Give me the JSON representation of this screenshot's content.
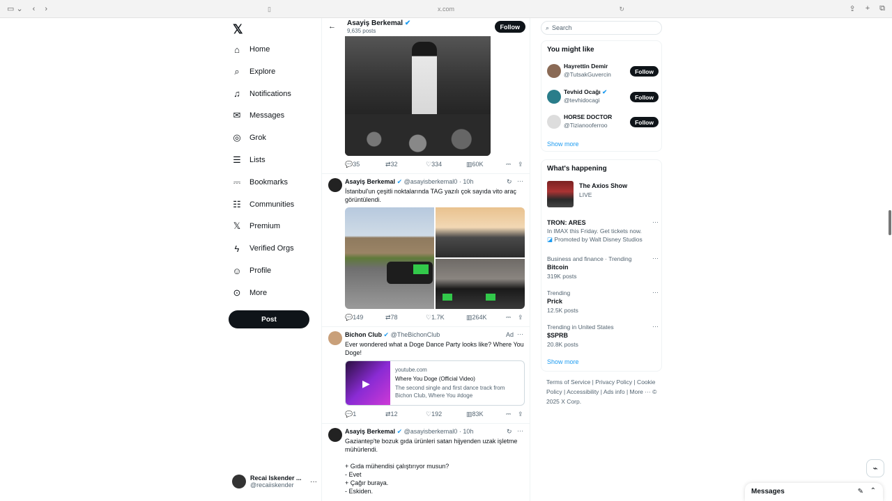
{
  "browser": {
    "url": "x.com"
  },
  "nav": {
    "items": [
      {
        "label": "Home",
        "icon": "home-icon",
        "glyph": "⌂"
      },
      {
        "label": "Explore",
        "icon": "search-icon",
        "glyph": "⌕"
      },
      {
        "label": "Notifications",
        "icon": "bell-icon",
        "glyph": "♫"
      },
      {
        "label": "Messages",
        "icon": "mail-icon",
        "glyph": "✉"
      },
      {
        "label": "Grok",
        "icon": "grok-icon",
        "glyph": "◎"
      },
      {
        "label": "Lists",
        "icon": "list-icon",
        "glyph": "☰"
      },
      {
        "label": "Bookmarks",
        "icon": "bookmark-icon",
        "glyph": "⎓"
      },
      {
        "label": "Communities",
        "icon": "communities-icon",
        "glyph": "☷"
      },
      {
        "label": "Premium",
        "icon": "x-icon",
        "glyph": "𝕏"
      },
      {
        "label": "Verified Orgs",
        "icon": "lightning-icon",
        "glyph": "ϟ"
      },
      {
        "label": "Profile",
        "icon": "profile-icon",
        "glyph": "☺"
      },
      {
        "label": "More",
        "icon": "more-icon",
        "glyph": "⊙"
      }
    ],
    "post_label": "Post",
    "me": {
      "name": "Recai Iskender ...",
      "handle": "@recaiiskender"
    }
  },
  "main": {
    "header": {
      "name": "Asayiş Berkemal",
      "posts": "9,635 posts",
      "follow": "Follow"
    },
    "tweet1_actions": {
      "replies": "35",
      "reposts": "32",
      "likes": "334",
      "views": "60K"
    },
    "tweet2": {
      "name": "Asayiş Berkemal",
      "handle": "@asayisberkemal0",
      "time": "· 10h",
      "text": "İstanbul'un çeşitli noktalarında TAG yazılı çok sayıda vito araç görüntülendi.",
      "actions": {
        "replies": "149",
        "reposts": "78",
        "likes": "1.7K",
        "views": "264K"
      }
    },
    "tweet3": {
      "name": "Bichon Club",
      "handle": "@TheBichonClub",
      "ad": "Ad",
      "text": "Ever wondered what a Doge Dance Party looks like? Where You Doge!",
      "card": {
        "domain": "youtube.com",
        "title": "Where You Doge (Official Video)",
        "desc": "The second single and first dance track from Bichon Club, Where You #doge"
      },
      "actions": {
        "replies": "1",
        "reposts": "12",
        "likes": "192",
        "views": "83K"
      }
    },
    "tweet4": {
      "name": "Asayiş Berkemal",
      "handle": "@asayisberkemal0",
      "time": "· 10h",
      "text": "Gaziantep'te bozuk gıda ürünleri satan hijyenden uzak işletme mühürlendi.\n\n+ Gıda mühendisi çalıştırıyor musun?\n- Evet\n+ Çağır buraya.\n- Eskiden."
    }
  },
  "right": {
    "search_placeholder": "Search",
    "might_like": {
      "title": "You might like",
      "users": [
        {
          "name": "Hayrettin Demir",
          "handle": "@TutsakGuvercin",
          "follow": "Follow"
        },
        {
          "name": "Tevhid Ocağı",
          "handle": "@tevhidocagi",
          "follow": "Follow"
        },
        {
          "name": "HORSE DOCTOR",
          "handle": "@Tizianooferroo",
          "follow": "Follow"
        }
      ],
      "show_more": "Show more"
    },
    "happening": {
      "title": "What's happening",
      "axios": {
        "title": "The Axios Show",
        "status": "LIVE"
      },
      "promo": {
        "title": "TRON: ARES",
        "line": "In IMAX this Friday. Get tickets now.",
        "promoted": "Promoted by Walt Disney Studios"
      },
      "trends": [
        {
          "context": "Business and finance · Trending",
          "title": "Bitcoin",
          "count": "319K posts"
        },
        {
          "context": "Trending",
          "title": "Prick",
          "count": "12.5K posts"
        },
        {
          "context": "Trending in United States",
          "title": "$SPRB",
          "count": "20.8K posts"
        }
      ],
      "show_more": "Show more"
    },
    "footer": "Terms of Service  |  Privacy Policy  |  Cookie Policy  |  Accessibility  |  Ads info  |  More ···  © 2025 X Corp."
  },
  "messages_dock": {
    "title": "Messages"
  },
  "colors": {
    "accent": "#1d9bf0",
    "dark": "#0f1419",
    "muted": "#536471"
  }
}
